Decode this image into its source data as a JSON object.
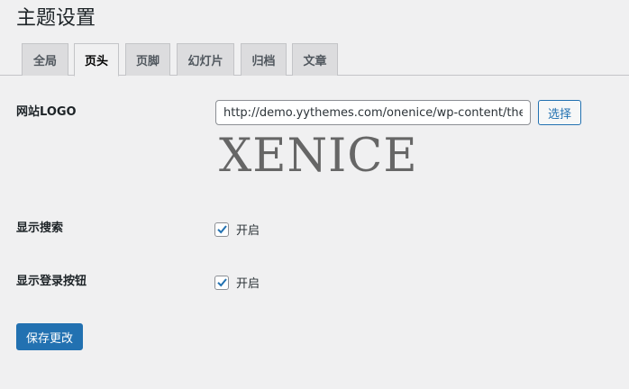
{
  "page": {
    "title": "主题设置"
  },
  "tabs": [
    {
      "label": "全局",
      "active": false
    },
    {
      "label": "页头",
      "active": true
    },
    {
      "label": "页脚",
      "active": false
    },
    {
      "label": "幻灯片",
      "active": false
    },
    {
      "label": "归档",
      "active": false
    },
    {
      "label": "文章",
      "active": false
    }
  ],
  "logo_setting": {
    "label": "网站LOGO",
    "url_value": "http://demo.yythemes.com/onenice/wp-content/themes/onenice/assets/images/logo.png",
    "select_label": "选择",
    "preview_text": "XENICE"
  },
  "search_setting": {
    "label": "显示搜索",
    "checked": true,
    "option_label": "开启"
  },
  "login_button_setting": {
    "label": "显示登录按钮",
    "checked": true,
    "option_label": "开启"
  },
  "save_label": "保存更改",
  "colors": {
    "accent": "#2271b1",
    "background": "#f0f0f1"
  }
}
